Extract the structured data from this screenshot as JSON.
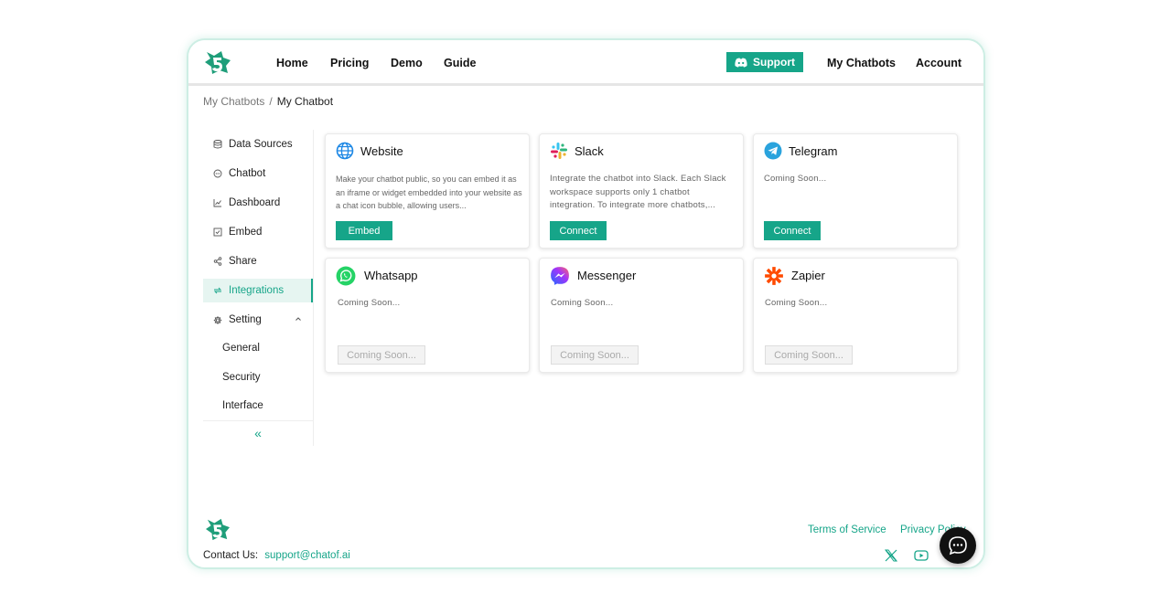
{
  "nav": {
    "home": "Home",
    "pricing": "Pricing",
    "demo": "Demo",
    "guide": "Guide",
    "support": "Support",
    "my_chatbots": "My Chatbots",
    "account": "Account"
  },
  "breadcrumb": {
    "parent": "My Chatbots",
    "separator": "/",
    "current": "My Chatbot"
  },
  "sidebar": {
    "items": [
      {
        "label": "Data Sources",
        "icon": "database-icon"
      },
      {
        "label": "Chatbot",
        "icon": "chat-icon"
      },
      {
        "label": "Dashboard",
        "icon": "chart-icon"
      },
      {
        "label": "Embed",
        "icon": "embed-icon"
      },
      {
        "label": "Share",
        "icon": "share-icon"
      },
      {
        "label": "Integrations",
        "icon": "integrations-icon",
        "active": true
      },
      {
        "label": "Setting",
        "icon": "gear-icon"
      }
    ],
    "sub_items": [
      "General",
      "Security",
      "Interface"
    ],
    "collapse_glyph": "«"
  },
  "cards": [
    {
      "title": "Website",
      "icon": "globe-icon",
      "desc": "Make your chatbot public, so you can embed it as an iframe or widget embedded into your website as a chat icon bubble, allowing users...",
      "button": "Embed"
    },
    {
      "title": "Slack",
      "icon": "slack-icon",
      "desc": "Integrate the chatbot into Slack. Each Slack workspace supports only 1 chatbot integration. To integrate more chatbots,...",
      "button": "Connect"
    },
    {
      "title": "Telegram",
      "icon": "telegram-icon",
      "desc": "Coming Soon...",
      "button": "Connect"
    },
    {
      "title": "Whatsapp",
      "icon": "whatsapp-icon",
      "desc": "Coming Soon...",
      "button": "Coming Soon..."
    },
    {
      "title": "Messenger",
      "icon": "messenger-icon",
      "desc": "Coming Soon...",
      "button": "Coming Soon..."
    },
    {
      "title": "Zapier",
      "icon": "zapier-icon",
      "desc": "Coming Soon...",
      "button": "Coming Soon..."
    }
  ],
  "footer": {
    "contact_label": "Contact Us:",
    "contact_email": "support@chatof.ai",
    "terms": "Terms of Service",
    "privacy": "Privacy Policy"
  },
  "colors": {
    "accent": "#16a589",
    "active_bg": "#e6f5f1"
  }
}
